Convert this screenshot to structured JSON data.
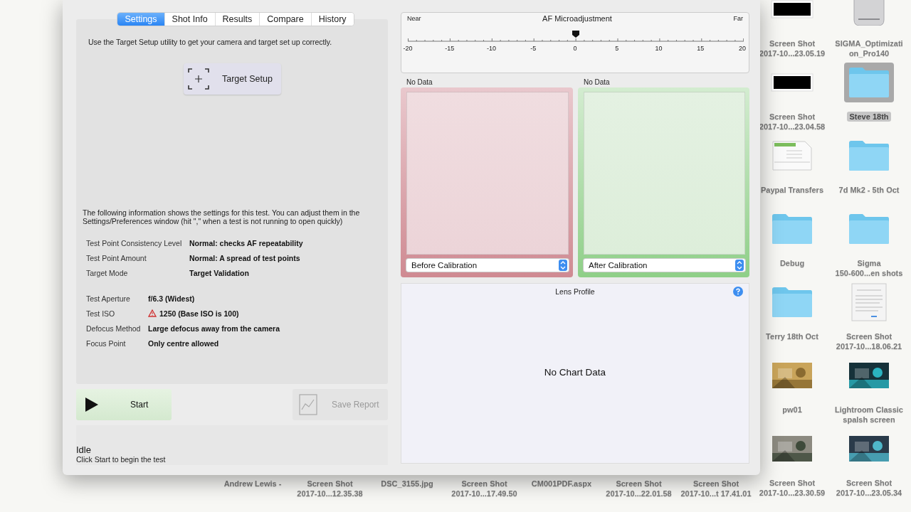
{
  "window": {
    "tabs": [
      {
        "label": "Settings",
        "selected": true
      },
      {
        "label": "Shot Info",
        "selected": false
      },
      {
        "label": "Results",
        "selected": false
      },
      {
        "label": "Compare",
        "selected": false
      },
      {
        "label": "History",
        "selected": false
      }
    ],
    "target_hint": "Use the Target Setup utility to get your camera and target set up correctly.",
    "target_setup_button": "Target Setup",
    "settings_intro": "The following information shows the settings for this test. You can adjust them in the Settings/Preferences window (hit \",\" when a test is not running to open quickly)",
    "test_settings": [
      {
        "label": "Test Point Consistency Level",
        "value": "Normal: checks AF repeatability"
      },
      {
        "label": "Test Point Amount",
        "value": "Normal: A spread of test points"
      },
      {
        "label": "Target Mode",
        "value": "Target Validation"
      }
    ],
    "shot_settings": [
      {
        "label": "Test Aperture",
        "value": "f/6.3 (Widest)",
        "warning": false
      },
      {
        "label": "Test ISO",
        "value": "1250 (Base ISO is 100)",
        "warning": true
      },
      {
        "label": "Defocus Method",
        "value": "Large defocus away from the camera",
        "warning": false
      },
      {
        "label": "Focus Point",
        "value": "Only centre allowed",
        "warning": false
      }
    ],
    "start_button": {
      "label": "Start",
      "disabled": false
    },
    "save_report_button": {
      "label": "Save Report",
      "disabled": true
    },
    "status": "Idle",
    "status_hint": "Click Start to begin the test",
    "af_microadjustment": {
      "title": "AF Microadjustment",
      "near_label": "Near",
      "far_label": "Far",
      "level": 0.5,
      "tick_labels": [
        "-20",
        "-15",
        "-10",
        "-5",
        "0",
        "5",
        "10",
        "15",
        "20"
      ]
    },
    "before_panel": {
      "caption": "No Data",
      "dropdown": "Before Calibration"
    },
    "after_panel": {
      "caption": "No Data",
      "dropdown": "After Calibration"
    },
    "lens_profile": {
      "title": "Lens Profile",
      "message": "No Chart Data"
    }
  },
  "desktop_icons": [
    {
      "kind": "blank",
      "lines": [
        "Screen Shot",
        "2017-10...23.05.19"
      ],
      "selected": false
    },
    {
      "kind": "drive",
      "lines": [
        "SIGMA_Optimizati",
        "on_Pro140"
      ],
      "selected": false
    },
    {
      "kind": "blank",
      "lines": [
        "Screen Shot",
        "2017-10...23.04.58"
      ],
      "selected": false
    },
    {
      "kind": "folder",
      "lines": [
        "Steve 18th"
      ],
      "selected": true
    },
    {
      "kind": "spreadsheet",
      "lines": [
        "Paypal Transfers"
      ],
      "selected": false
    },
    {
      "kind": "folder",
      "lines": [
        "7d Mk2 - 5th Oct"
      ],
      "selected": false
    },
    {
      "kind": "folder",
      "lines": [
        "Debug"
      ],
      "selected": false
    },
    {
      "kind": "folder",
      "lines": [
        "Sigma",
        "150-600...en shots"
      ],
      "selected": false
    },
    {
      "kind": "folder",
      "lines": [
        "Terry 18th Oct"
      ],
      "selected": false
    },
    {
      "kind": "document",
      "lines": [
        "Screen Shot",
        "2017-10...18.06.21"
      ],
      "selected": false
    },
    {
      "kind": "picture",
      "lines": [
        "pw01"
      ],
      "selected": false
    },
    {
      "kind": "picture",
      "lines": [
        "Lightroom Classic",
        "spalsh screen"
      ],
      "selected": false
    },
    {
      "kind": "picture",
      "lines": [
        "Screen Shot",
        "2017-10...23.30.59"
      ],
      "selected": false
    },
    {
      "kind": "picture",
      "lines": [
        "Screen Shot",
        "2017-10...23.05.34"
      ],
      "selected": false
    }
  ],
  "desktop_bottom_labels": [
    {
      "lines": [
        "Andrew Lewis -"
      ]
    },
    {
      "lines": [
        "Screen Shot",
        "2017-10...12.35.38"
      ]
    },
    {
      "lines": [
        "DSC_3155.jpg"
      ]
    },
    {
      "lines": [
        "Screen Shot",
        "2017-10...17.49.50"
      ]
    },
    {
      "lines": [
        "CM001PDF.aspx"
      ]
    },
    {
      "lines": [
        "Screen Shot",
        "2017-10...22.01.58"
      ]
    },
    {
      "lines": [
        "Screen Shot",
        "2017-10...t 17.41.01"
      ]
    }
  ]
}
